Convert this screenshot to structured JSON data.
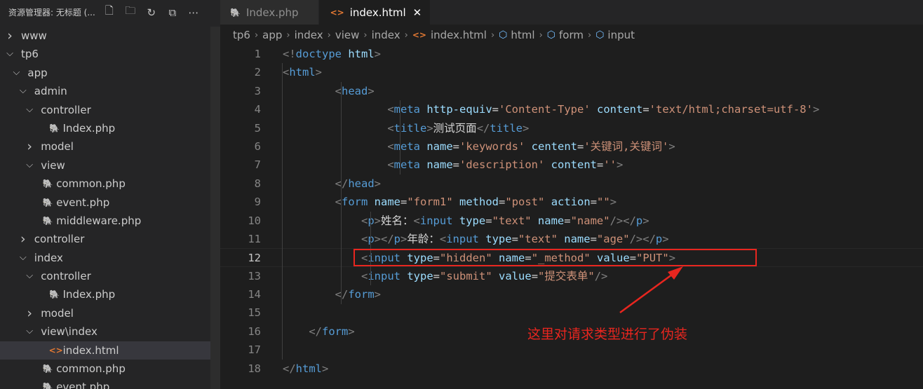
{
  "sidebar": {
    "title": "资源管理器: 无标题 (...",
    "actions": [
      {
        "name": "new-file-icon",
        "glyph": "🗋"
      },
      {
        "name": "new-folder-icon",
        "glyph": "🗀"
      },
      {
        "name": "refresh-icon",
        "glyph": "↻"
      },
      {
        "name": "collapse-all-icon",
        "glyph": "⧉"
      },
      {
        "name": "more-actions-icon",
        "glyph": "⋯"
      }
    ],
    "tree": [
      {
        "label": "www",
        "kind": "folder",
        "expanded": false,
        "depth": 0
      },
      {
        "label": "tp6",
        "kind": "folder",
        "expanded": true,
        "depth": 0
      },
      {
        "label": "app",
        "kind": "folder",
        "expanded": true,
        "depth": 1
      },
      {
        "label": "admin",
        "kind": "folder",
        "expanded": true,
        "depth": 2
      },
      {
        "label": "controller",
        "kind": "folder",
        "expanded": true,
        "depth": 3
      },
      {
        "label": "Index.php",
        "kind": "php",
        "depth": 4
      },
      {
        "label": "model",
        "kind": "folder",
        "expanded": false,
        "depth": 3
      },
      {
        "label": "view",
        "kind": "folder",
        "expanded": true,
        "depth": 3
      },
      {
        "label": "common.php",
        "kind": "php",
        "depth": 3
      },
      {
        "label": "event.php",
        "kind": "php",
        "depth": 3
      },
      {
        "label": "middleware.php",
        "kind": "php",
        "depth": 3
      },
      {
        "label": "controller",
        "kind": "folder",
        "expanded": false,
        "depth": 2
      },
      {
        "label": "index",
        "kind": "folder",
        "expanded": true,
        "depth": 2
      },
      {
        "label": "controller",
        "kind": "folder",
        "expanded": true,
        "depth": 3
      },
      {
        "label": "Index.php",
        "kind": "php",
        "depth": 4
      },
      {
        "label": "model",
        "kind": "folder",
        "expanded": false,
        "depth": 3
      },
      {
        "label": "view\\index",
        "kind": "folder",
        "expanded": true,
        "depth": 3
      },
      {
        "label": "index.html",
        "kind": "html",
        "depth": 4,
        "selected": true
      },
      {
        "label": "common.php",
        "kind": "php",
        "depth": 3
      },
      {
        "label": "event.php",
        "kind": "php",
        "depth": 3
      }
    ]
  },
  "tabs": [
    {
      "label": "Index.php",
      "kind": "php",
      "active": false
    },
    {
      "label": "index.html",
      "kind": "html",
      "active": true,
      "close": "✕"
    }
  ],
  "breadcrumb": [
    {
      "label": "tp6"
    },
    {
      "label": "app"
    },
    {
      "label": "index"
    },
    {
      "label": "view"
    },
    {
      "label": "index"
    },
    {
      "label": "index.html",
      "icon": "html"
    },
    {
      "label": "html",
      "icon": "cube"
    },
    {
      "label": "form",
      "icon": "cube"
    },
    {
      "label": "input",
      "icon": "cube"
    }
  ],
  "editor": {
    "current_line": 12,
    "lines": [
      [
        [
          "b",
          "<!"
        ],
        [
          "k",
          "doctype"
        ],
        [
          "t",
          " "
        ],
        [
          "a",
          "html"
        ],
        [
          "b",
          ">"
        ]
      ],
      [
        [
          "b",
          "<"
        ],
        [
          "k",
          "html"
        ],
        [
          "b",
          ">"
        ]
      ],
      [
        [
          "t",
          "        "
        ],
        [
          "b",
          "<"
        ],
        [
          "k",
          "head"
        ],
        [
          "b",
          ">"
        ]
      ],
      [
        [
          "t",
          "                "
        ],
        [
          "b",
          "<"
        ],
        [
          "k",
          "meta"
        ],
        [
          "t",
          " "
        ],
        [
          "a",
          "http-equiv"
        ],
        [
          "t",
          "="
        ],
        [
          "s",
          "'Content-Type'"
        ],
        [
          "t",
          " "
        ],
        [
          "a",
          "content"
        ],
        [
          "t",
          "="
        ],
        [
          "s",
          "'text/html;charset=utf-8'"
        ],
        [
          "b",
          ">"
        ]
      ],
      [
        [
          "t",
          "                "
        ],
        [
          "b",
          "<"
        ],
        [
          "k",
          "title"
        ],
        [
          "b",
          ">"
        ],
        [
          "t",
          "测试页面"
        ],
        [
          "b",
          "</"
        ],
        [
          "k",
          "title"
        ],
        [
          "b",
          ">"
        ]
      ],
      [
        [
          "t",
          "                "
        ],
        [
          "b",
          "<"
        ],
        [
          "k",
          "meta"
        ],
        [
          "t",
          " "
        ],
        [
          "a",
          "name"
        ],
        [
          "t",
          "="
        ],
        [
          "s",
          "'keywords'"
        ],
        [
          "t",
          " "
        ],
        [
          "a",
          "centent"
        ],
        [
          "t",
          "="
        ],
        [
          "s",
          "'关键词,关键词'"
        ],
        [
          "b",
          ">"
        ]
      ],
      [
        [
          "t",
          "                "
        ],
        [
          "b",
          "<"
        ],
        [
          "k",
          "meta"
        ],
        [
          "t",
          " "
        ],
        [
          "a",
          "name"
        ],
        [
          "t",
          "="
        ],
        [
          "s",
          "'description'"
        ],
        [
          "t",
          " "
        ],
        [
          "a",
          "content"
        ],
        [
          "t",
          "="
        ],
        [
          "s",
          "''"
        ],
        [
          "b",
          ">"
        ]
      ],
      [
        [
          "t",
          "        "
        ],
        [
          "b",
          "</"
        ],
        [
          "k",
          "head"
        ],
        [
          "b",
          ">"
        ]
      ],
      [
        [
          "t",
          "        "
        ],
        [
          "b",
          "<"
        ],
        [
          "k",
          "form"
        ],
        [
          "t",
          " "
        ],
        [
          "a",
          "name"
        ],
        [
          "t",
          "="
        ],
        [
          "s",
          "\"form1\""
        ],
        [
          "t",
          " "
        ],
        [
          "a",
          "method"
        ],
        [
          "t",
          "="
        ],
        [
          "s",
          "\"post\""
        ],
        [
          "t",
          " "
        ],
        [
          "a",
          "action"
        ],
        [
          "t",
          "="
        ],
        [
          "s",
          "\"\""
        ],
        [
          "b",
          ">"
        ]
      ],
      [
        [
          "t",
          "            "
        ],
        [
          "b",
          "<"
        ],
        [
          "k",
          "p"
        ],
        [
          "b",
          ">"
        ],
        [
          "t",
          "姓名："
        ],
        [
          "b",
          "<"
        ],
        [
          "k",
          "input"
        ],
        [
          "t",
          " "
        ],
        [
          "a",
          "type"
        ],
        [
          "t",
          "="
        ],
        [
          "s",
          "\"text\""
        ],
        [
          "t",
          " "
        ],
        [
          "a",
          "name"
        ],
        [
          "t",
          "="
        ],
        [
          "s",
          "\"name\""
        ],
        [
          "b",
          "/></"
        ],
        [
          "k",
          "p"
        ],
        [
          "b",
          ">"
        ]
      ],
      [
        [
          "t",
          "            "
        ],
        [
          "b",
          "<"
        ],
        [
          "k",
          "p"
        ],
        [
          "b",
          "></"
        ],
        [
          "k",
          "p"
        ],
        [
          "b",
          ">"
        ],
        [
          "t",
          "年龄："
        ],
        [
          "b",
          "<"
        ],
        [
          "k",
          "input"
        ],
        [
          "t",
          " "
        ],
        [
          "a",
          "type"
        ],
        [
          "t",
          "="
        ],
        [
          "s",
          "\"text\""
        ],
        [
          "t",
          " "
        ],
        [
          "a",
          "name"
        ],
        [
          "t",
          "="
        ],
        [
          "s",
          "\"age\""
        ],
        [
          "b",
          "/></"
        ],
        [
          "k",
          "p"
        ],
        [
          "b",
          ">"
        ]
      ],
      [
        [
          "t",
          "            "
        ],
        [
          "b",
          "<"
        ],
        [
          "k",
          "input"
        ],
        [
          "t",
          " "
        ],
        [
          "a",
          "type"
        ],
        [
          "t",
          "="
        ],
        [
          "s",
          "\"hidden\""
        ],
        [
          "t",
          " "
        ],
        [
          "a",
          "name"
        ],
        [
          "t",
          "="
        ],
        [
          "s",
          "\"_method\""
        ],
        [
          "t",
          " "
        ],
        [
          "a",
          "value"
        ],
        [
          "t",
          "="
        ],
        [
          "s",
          "\"PUT\""
        ],
        [
          "b",
          ">"
        ]
      ],
      [
        [
          "t",
          "            "
        ],
        [
          "b",
          "<"
        ],
        [
          "k",
          "input"
        ],
        [
          "t",
          " "
        ],
        [
          "a",
          "type"
        ],
        [
          "t",
          "="
        ],
        [
          "s",
          "\"submit\""
        ],
        [
          "t",
          " "
        ],
        [
          "a",
          "value"
        ],
        [
          "t",
          "="
        ],
        [
          "s",
          "\"提交表单\""
        ],
        [
          "b",
          "/>"
        ]
      ],
      [
        [
          "t",
          "        "
        ],
        [
          "b",
          "</"
        ],
        [
          "k",
          "form"
        ],
        [
          "b",
          ">"
        ]
      ],
      [
        [
          "t",
          ""
        ]
      ],
      [
        [
          "t",
          "    "
        ],
        [
          "b",
          "</"
        ],
        [
          "k",
          "form"
        ],
        [
          "b",
          ">"
        ]
      ],
      [
        [
          "t",
          ""
        ]
      ],
      [
        [
          "b",
          "</"
        ],
        [
          "k",
          "html"
        ],
        [
          "b",
          ">"
        ]
      ]
    ]
  },
  "annotation": {
    "text": "这里对请求类型进行了伪装"
  },
  "colors": {
    "tag_bracket": "#808080",
    "tag_name": "#569cd6",
    "attr_name": "#9cdcfe",
    "string": "#ce9178",
    "text": "#d4d4d4",
    "php_icon": "#a074c4",
    "html_icon": "#e37933",
    "annotation_red": "#e8261f"
  }
}
